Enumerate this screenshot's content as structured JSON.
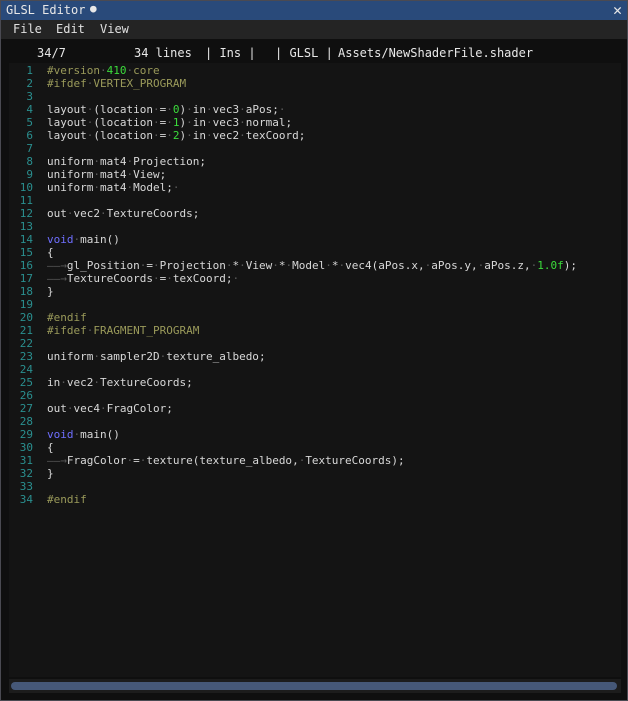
{
  "window": {
    "title": "GLSL Editor",
    "modified_marker": "●",
    "close_glyph": "✕"
  },
  "menu": {
    "items": [
      "File",
      "Edit",
      "View"
    ]
  },
  "status": {
    "position": "34/7",
    "line_count": "34 lines",
    "mode": "| Ins |",
    "language": "| GLSL |",
    "file_path": "Assets/NewShaderFile.shader"
  },
  "editor": {
    "lines": [
      "#version·410·core",
      "#ifdef·VERTEX_PROGRAM",
      "",
      "layout·(location·=·0)·in·vec3·aPos;·",
      "layout·(location·=·1)·in·vec3·normal;",
      "layout·(location·=·2)·in·vec2·texCoord;",
      "",
      "uniform·mat4·Projection;",
      "uniform·mat4·View;",
      "uniform·mat4·Model;·",
      "",
      "out·vec2·TextureCoords;",
      "",
      "void·main()",
      "{",
      "→gl_Position·=·Projection·*·View·*·Model·*·vec4(aPos.x,·aPos.y,·aPos.z,·1.0f);",
      "→TextureCoords·=·texCoord;·",
      "}",
      "",
      "#endif",
      "#ifdef·FRAGMENT_PROGRAM",
      "",
      "uniform·sampler2D·texture_albedo;",
      "",
      "in·vec2·TextureCoords;",
      "",
      "out·vec4·FragColor;",
      "",
      "void·main()",
      "{",
      "→FragColor·=·texture(texture_albedo,·TextureCoords);",
      "}",
      "",
      "#endif"
    ]
  },
  "colors": {
    "title_bar": "#294a7a",
    "line_number": "#2a8f8f",
    "keyword": "#6f6fff",
    "preprocessor": "#9a9a5a",
    "number": "#3bdc3b",
    "text": "#d8d8d8",
    "scrollbar_thumb": "#465878"
  }
}
